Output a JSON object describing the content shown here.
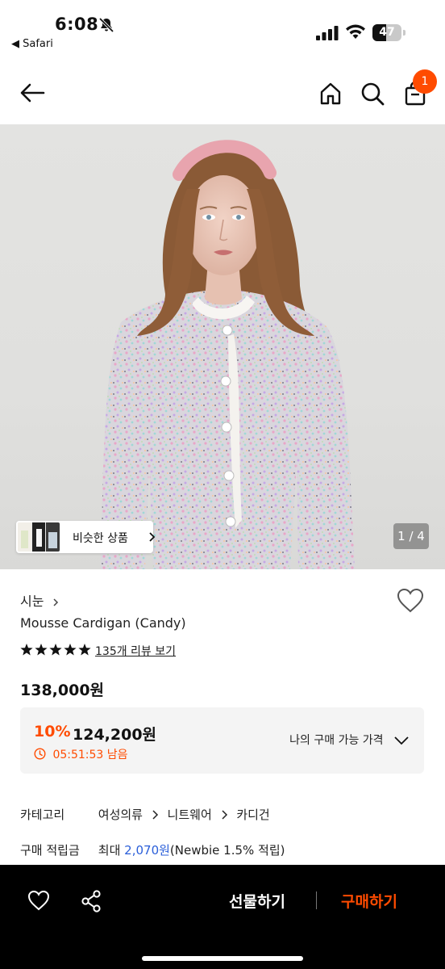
{
  "status_bar": {
    "time": "6:08",
    "back_app": "◀ Safari",
    "battery_level": "47",
    "battery_fraction": 0.47
  },
  "nav": {
    "cart_badge_count": "1",
    "icons": [
      "back-arrow-icon",
      "home-icon",
      "search-icon",
      "shopping-bag-icon"
    ]
  },
  "gallery": {
    "similar_label": "비슷한 상품",
    "page_indicator": "1 / 4"
  },
  "product": {
    "brand": "시눈",
    "name": "Mousse Cardigan (Candy)",
    "rating_stars": 5,
    "review_link": "135개 리뷰 보기",
    "price": "138,000원",
    "discount": {
      "rate": "10%",
      "price": "124,200원",
      "timer": "05:51:53 남음",
      "my_price_label": "나의 구매 가능 가격"
    }
  },
  "details": {
    "category_label": "카테고리",
    "category_path": [
      "여성의류",
      "니트웨어",
      "카디건"
    ],
    "points_label": "구매 적립금",
    "points_prefix": "최대",
    "points_value": "2,070원",
    "points_suffix": "(Newbie 1.5% 적립)"
  },
  "bottom_bar": {
    "gift_label": "선물하기",
    "buy_label": "구매하기"
  },
  "colors": {
    "accent": "#ff4b00",
    "points_blue": "#2b5fd9",
    "bottom_bar_bg": "#000000",
    "discount_box_bg": "#f4f4f4"
  }
}
